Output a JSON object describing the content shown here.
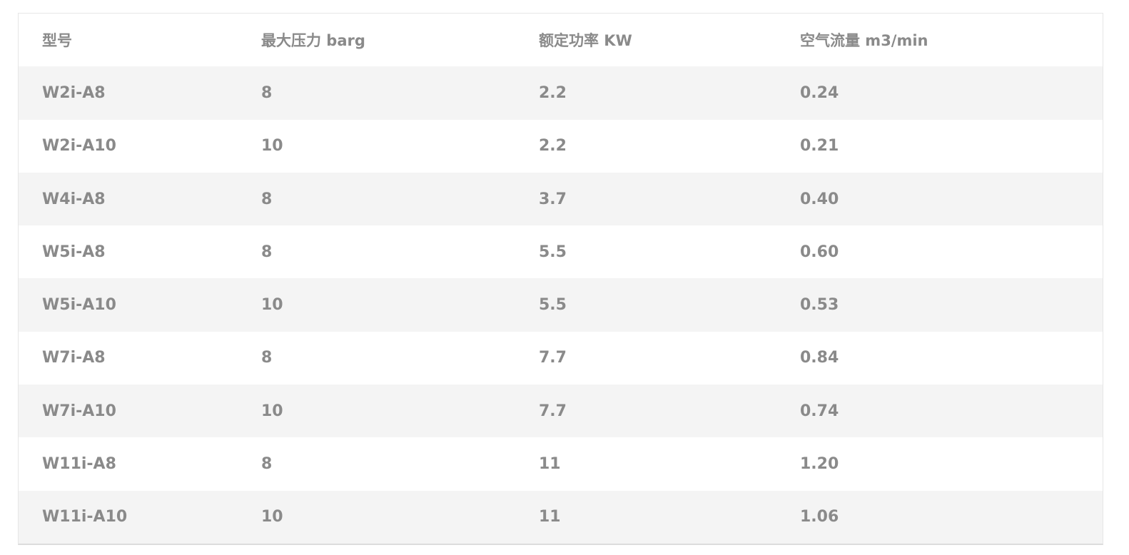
{
  "table": {
    "headers": [
      "型号",
      "最大压力 barg",
      "额定功率 KW",
      "空气流量 m3/min"
    ],
    "rows": [
      [
        "W2i-A8",
        "8",
        "2.2",
        "0.24"
      ],
      [
        "W2i-A10",
        "10",
        "2.2",
        "0.21"
      ],
      [
        "W4i-A8",
        "8",
        "3.7",
        "0.40"
      ],
      [
        "W5i-A8",
        "8",
        "5.5",
        "0.60"
      ],
      [
        "W5i-A10",
        "10",
        "5.5",
        "0.53"
      ],
      [
        "W7i-A8",
        "8",
        "7.7",
        "0.84"
      ],
      [
        "W7i-A10",
        "10",
        "7.7",
        "0.74"
      ],
      [
        "W11i-A8",
        "8",
        "11",
        "1.20"
      ],
      [
        "W11i-A10",
        "10",
        "11",
        "1.06"
      ]
    ]
  },
  "colors": {
    "text": "#8a8a8a",
    "row_alt": "#f4f4f4",
    "row_base": "#ffffff",
    "border": "#e6e6e6"
  }
}
